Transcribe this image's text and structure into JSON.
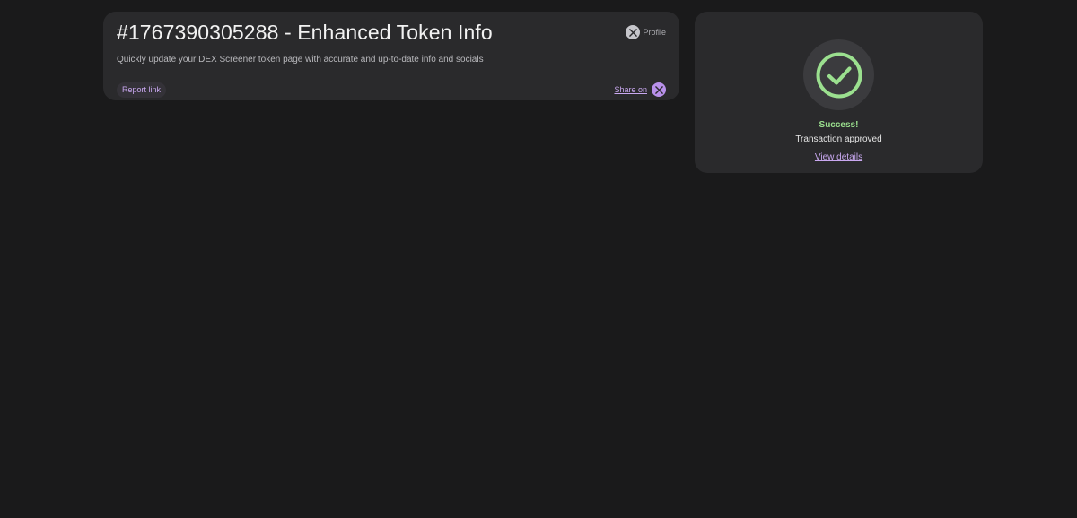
{
  "order": {
    "title": "#1767390305288 - Enhanced Token Info",
    "description": "Quickly update your DEX Screener token page with accurate and up-to-date info and socials",
    "report_link_label": "Report link",
    "profile_label": "Profile",
    "share_label": "Share on",
    "profile_icon": "x-logo-icon",
    "share_icon": "x-logo-icon"
  },
  "status": {
    "icon": "check-circle-icon",
    "title": "Success!",
    "message": "Transaction approved",
    "details_link_label": "View details"
  },
  "colors": {
    "background": "#1a1a1b",
    "card": "#2a2a2c",
    "accent": "#c9a8f0",
    "success": "#9be08f"
  }
}
